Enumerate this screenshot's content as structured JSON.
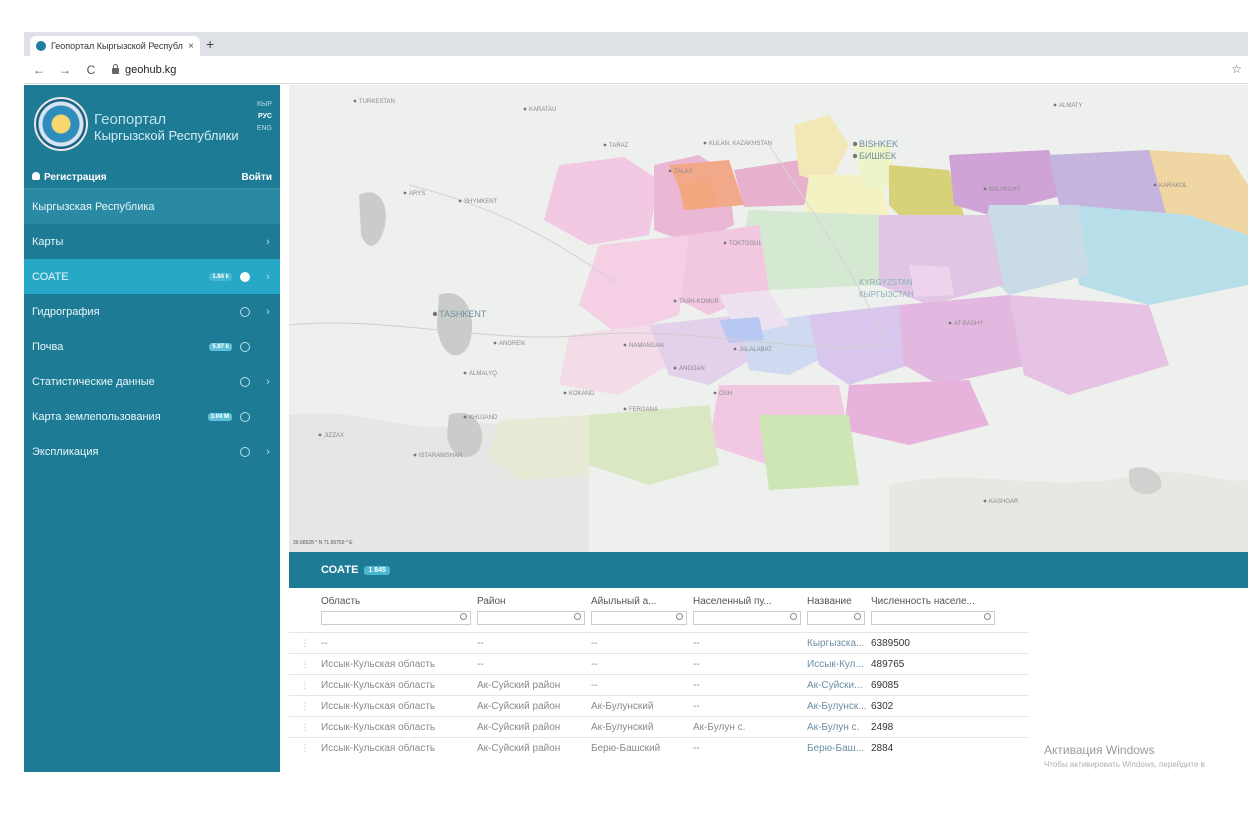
{
  "browser": {
    "tab_title": "Геопортал Кыргызской Республ",
    "tab_close": "×",
    "new_tab": "+",
    "back": "←",
    "forward": "→",
    "reload": "C",
    "url": "geohub.kg",
    "star": "☆"
  },
  "sidebar": {
    "title": "Геопортал",
    "subtitle": "Кыргызской Республики",
    "languages": [
      {
        "label": "КЫР",
        "active": false
      },
      {
        "label": "РУС",
        "active": true
      },
      {
        "label": "ENG",
        "active": false
      }
    ],
    "register": "Регистрация",
    "login": "Войти",
    "items": [
      {
        "label": "Кыргызская Республика",
        "badge": "",
        "toggle": "none",
        "chevron": false
      },
      {
        "label": "Карты",
        "badge": "",
        "toggle": "none",
        "chevron": true
      },
      {
        "label": "СОАТЕ",
        "badge": "1.84 k",
        "toggle": "on",
        "chevron": true
      },
      {
        "label": "Гидрография",
        "badge": "",
        "toggle": "off",
        "chevron": true
      },
      {
        "label": "Почва",
        "badge": "5.97 k",
        "toggle": "off",
        "chevron": false
      },
      {
        "label": "Статистические данные",
        "badge": "",
        "toggle": "off",
        "chevron": true
      },
      {
        "label": "Карта землепользования",
        "badge": "3.04 M",
        "toggle": "off",
        "chevron": false
      },
      {
        "label": "Экспликация",
        "badge": "",
        "toggle": "off",
        "chevron": true
      }
    ],
    "chevron_glyph": "›"
  },
  "map": {
    "coords": "39.66528 ° N  71.65759 ° E",
    "labels": [
      {
        "text": "TURKESTAN",
        "type": "city"
      },
      {
        "text": "KARATAU",
        "type": "city"
      },
      {
        "text": "TARAZ",
        "type": "city"
      },
      {
        "text": "KULAN, KAZAKHSTAN",
        "type": "city"
      },
      {
        "text": "BISHKEK",
        "type": "capital"
      },
      {
        "text": "БИШКЕК",
        "type": "capital"
      },
      {
        "text": "ALMATY",
        "type": "city"
      },
      {
        "text": "ARYS",
        "type": "city"
      },
      {
        "text": "SHYMKENT",
        "type": "city"
      },
      {
        "text": "TALAS",
        "type": "city"
      },
      {
        "text": "BALYKCHY",
        "type": "city"
      },
      {
        "text": "KARAKOL",
        "type": "city"
      },
      {
        "text": "TOKTOGUL",
        "type": "city"
      },
      {
        "text": "TASHKENT",
        "type": "capital"
      },
      {
        "text": "KYRGYZSTAN",
        "type": "country"
      },
      {
        "text": "КЫРГЫЗСТАН",
        "type": "country"
      },
      {
        "text": "TASH-KOMUR",
        "type": "city"
      },
      {
        "text": "ANGREN",
        "type": "city"
      },
      {
        "text": "NAMANGAN",
        "type": "city"
      },
      {
        "text": "ALMALYQ",
        "type": "city"
      },
      {
        "text": "JALALABAT",
        "type": "city"
      },
      {
        "text": "AT-BASHY",
        "type": "city"
      },
      {
        "text": "ANDIJAN",
        "type": "city"
      },
      {
        "text": "KOKAND",
        "type": "city"
      },
      {
        "text": "OSH",
        "type": "city"
      },
      {
        "text": "FERGANA",
        "type": "city"
      },
      {
        "text": "KHUJAND",
        "type": "city"
      },
      {
        "text": "JIZZAX",
        "type": "city"
      },
      {
        "text": "ISTARAWSHAN",
        "type": "city"
      },
      {
        "text": "KASHGAR",
        "type": "city"
      }
    ]
  },
  "panel": {
    "title": "СОАТЕ",
    "count": "1 845"
  },
  "table": {
    "columns": [
      "Область",
      "Район",
      "Айыльный а...",
      "Населенный пу...",
      "Название",
      "Численность населе..."
    ],
    "rows": [
      [
        "--",
        "--",
        "--",
        "--",
        "Кыргызска...",
        "6389500"
      ],
      [
        "Иссык-Кульская область",
        "--",
        "--",
        "--",
        "Иссык-Кул...",
        "489765"
      ],
      [
        "Иссык-Кульская область",
        "Ак-Суйский район",
        "--",
        "--",
        "Ак-Суйски...",
        "69085"
      ],
      [
        "Иссык-Кульская область",
        "Ак-Суйский район",
        "Ак-Булунский",
        "--",
        "Ак-Булунск...",
        "6302"
      ],
      [
        "Иссык-Кульская область",
        "Ак-Суйский район",
        "Ак-Булунский",
        "Ак-Булун с.",
        "Ак-Булун с.",
        "2498"
      ],
      [
        "Иссык-Кульская область",
        "Ак-Суйский район",
        "Берю-Башский",
        "--",
        "Берю-Баш...",
        "2884"
      ]
    ],
    "row_handle": "⋮"
  },
  "watermark": {
    "line1": "Активация Windows",
    "line2": "Чтобы активировать Windows, перейдите в"
  },
  "colors": {
    "sidebar": "#1e7b95",
    "sidebar_active": "#27a8c6",
    "map_background": "#eef0ed"
  }
}
